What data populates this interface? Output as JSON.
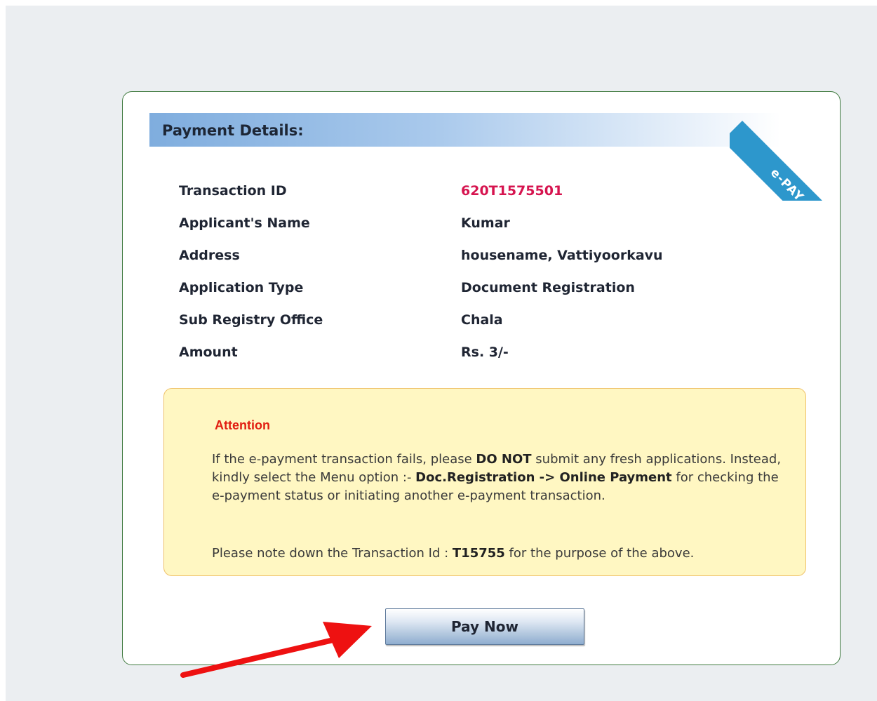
{
  "payment": {
    "header": "Payment Details:",
    "ribbon_label": "e-PAY",
    "rows": [
      {
        "label": "Transaction ID",
        "value": "620T1575501"
      },
      {
        "label": "Applicant's Name",
        "value": "Kumar"
      },
      {
        "label": "Address",
        "value": "housename, Vattiyoorkavu"
      },
      {
        "label": "Application Type",
        "value": "Document Registration"
      },
      {
        "label": "Sub Registry Office",
        "value": "Chala"
      },
      {
        "label": "Amount",
        "value": "Rs. 3/-"
      }
    ]
  },
  "attention": {
    "title": "Attention",
    "p1_part1": "If the e-payment transaction fails, please ",
    "p1_bold1": "DO NOT",
    "p1_part2": " submit any fresh applications. Instead, kindly select the Menu option :- ",
    "p1_bold2": "Doc.Registration -> Online Payment",
    "p1_part3": " for checking the e-payment status or initiating another e-payment transaction.",
    "p2_part1": "Please note down the Transaction Id : ",
    "p2_bold": "T15755",
    "p2_part2": " for the purpose of the above."
  },
  "actions": {
    "pay_now_label": "Pay Now"
  },
  "icons": {
    "annotation": "red-arrow-icon"
  },
  "colors": {
    "transaction_id": "#d6144f",
    "attention_title": "#e11e11",
    "ribbon": "#2d97cc",
    "card_border": "#3f7a3f",
    "arrow": "#ee1111"
  }
}
